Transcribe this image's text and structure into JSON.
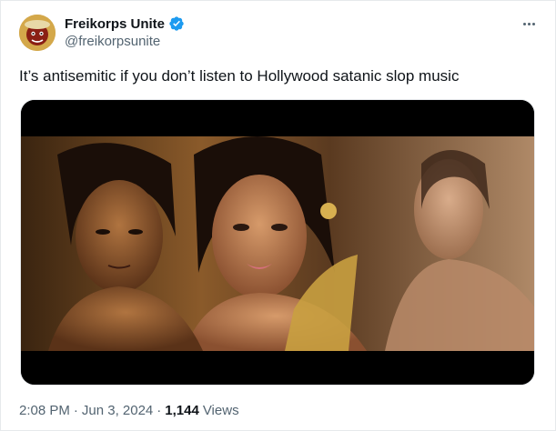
{
  "author": {
    "display_name": "Freikorps Unite",
    "handle": "@freikorpsunite",
    "verified_icon": "verified-badge-icon",
    "verified_color": "#1d9bf0"
  },
  "more_icon": "more-horizontal-icon",
  "tweet": {
    "text": "It’s antisemitic if you don’t listen to Hollywood satanic slop music"
  },
  "media": {
    "type": "video-still"
  },
  "meta": {
    "time": "2:08 PM",
    "separator": "·",
    "date": "Jun 3, 2024",
    "views_count": "1,144",
    "views_label": "Views"
  },
  "colors": {
    "text_primary": "#0f1419",
    "text_secondary": "#536471",
    "border": "#e6e9ec"
  }
}
